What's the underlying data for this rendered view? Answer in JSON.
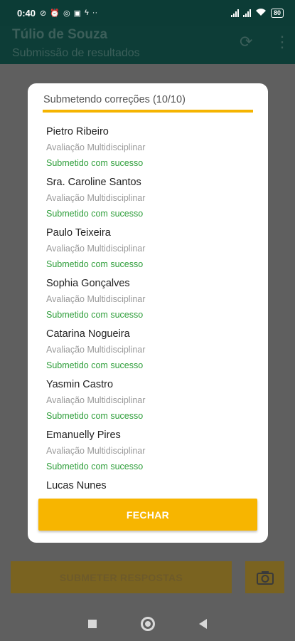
{
  "status_bar": {
    "time": "0:40",
    "left_icons": [
      "sync-off-icon",
      "alarm-icon",
      "instagram-icon",
      "news-icon",
      "power-icon",
      "more-dots-icon"
    ],
    "battery": "80"
  },
  "app_bar": {
    "title": "Túlio de Souza",
    "subtitle": "Submissão de resultados",
    "actions": [
      "refresh-icon",
      "overflow-menu-icon"
    ]
  },
  "dialog": {
    "title": "Submetendo correções (10/10)",
    "progress": 1.0,
    "items": [
      {
        "name": "Pietro Ribeiro",
        "exam": "Avaliação Multidisciplinar",
        "status": "Submetido com sucesso"
      },
      {
        "name": "Sra. Caroline Santos",
        "exam": "Avaliação Multidisciplinar",
        "status": "Submetido com sucesso"
      },
      {
        "name": "Paulo Teixeira",
        "exam": "Avaliação Multidisciplinar",
        "status": "Submetido com sucesso"
      },
      {
        "name": "Sophia Gonçalves",
        "exam": "Avaliação Multidisciplinar",
        "status": "Submetido com sucesso"
      },
      {
        "name": "Catarina Nogueira",
        "exam": "Avaliação Multidisciplinar",
        "status": "Submetido com sucesso"
      },
      {
        "name": "Yasmin Castro",
        "exam": "Avaliação Multidisciplinar",
        "status": "Submetido com sucesso"
      },
      {
        "name": "Emanuelly Pires",
        "exam": "Avaliação Multidisciplinar",
        "status": "Submetido com sucesso"
      },
      {
        "name": "Lucas Nunes",
        "exam": "",
        "status": ""
      }
    ],
    "close_label": "FECHAR"
  },
  "bottom": {
    "submit_label": "SUBMETER RESPOSTAS",
    "camera_icon": "camera-icon"
  },
  "colors": {
    "accent": "#f7b500",
    "success": "#2e9e3a",
    "app_bar": "#0d3d37"
  }
}
